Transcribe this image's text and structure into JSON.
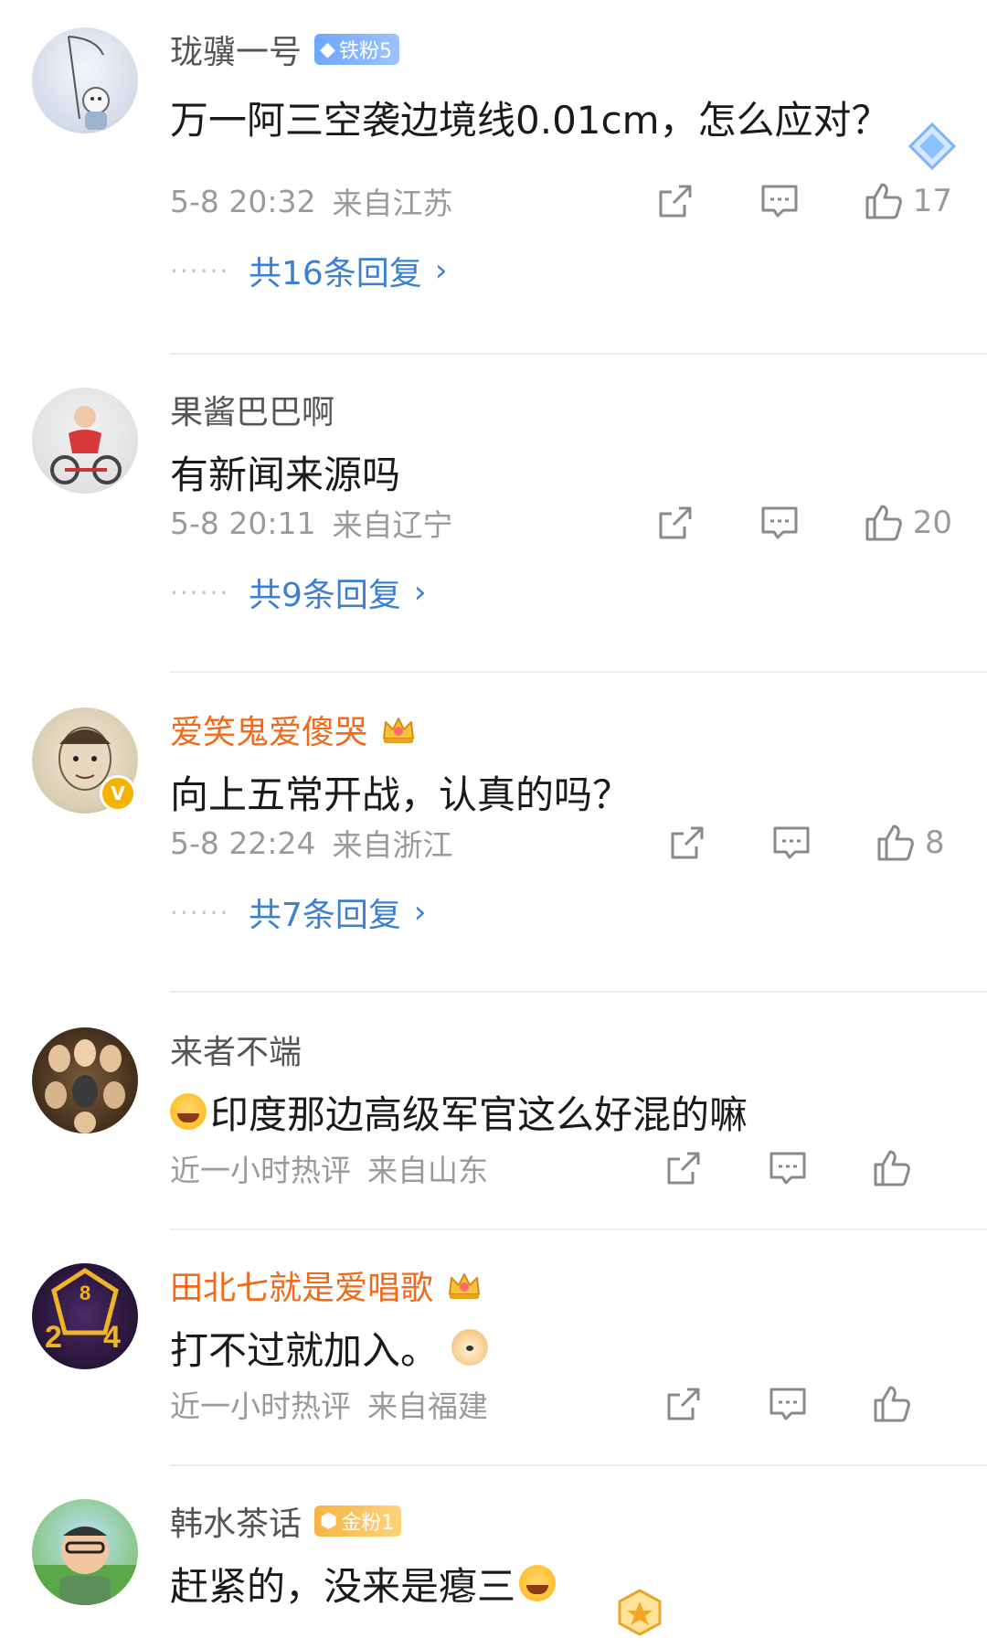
{
  "comments": [
    {
      "username": "珑骥一号",
      "badge": "铁粉5",
      "content": "万一阿三空袭边境线0.01cm，怎么应对？",
      "time": "5-8 20:32",
      "location": "来自江苏",
      "likes": "17",
      "replies": "共16条回复"
    },
    {
      "username": "果酱巴巴啊",
      "content": "有新闻来源吗",
      "time": "5-8 20:11",
      "location": "来自辽宁",
      "likes": "20",
      "replies": "共9条回复"
    },
    {
      "username": "爱笑鬼爱傻哭",
      "content": "向上五常开战，认真的吗？",
      "time": "5-8 22:24",
      "location": "来自浙江",
      "likes": "8",
      "replies": "共7条回复"
    },
    {
      "username": "来者不端",
      "content": "印度那边高级军官这么好混的嘛",
      "time": "近一小时热评",
      "location": "来自山东"
    },
    {
      "username": "田北七就是爱唱歌",
      "content": "打不过就加入。",
      "time": "近一小时热评",
      "location": "来自福建"
    },
    {
      "username": "韩水茶话",
      "badge": "金粉1",
      "content": "赶紧的，没来是瘪三"
    }
  ],
  "colors": {
    "username_default": "#555555",
    "username_vip": "#f06a1a",
    "reply_link": "#3d7fd1",
    "meta_gray": "#9a9a9a"
  }
}
